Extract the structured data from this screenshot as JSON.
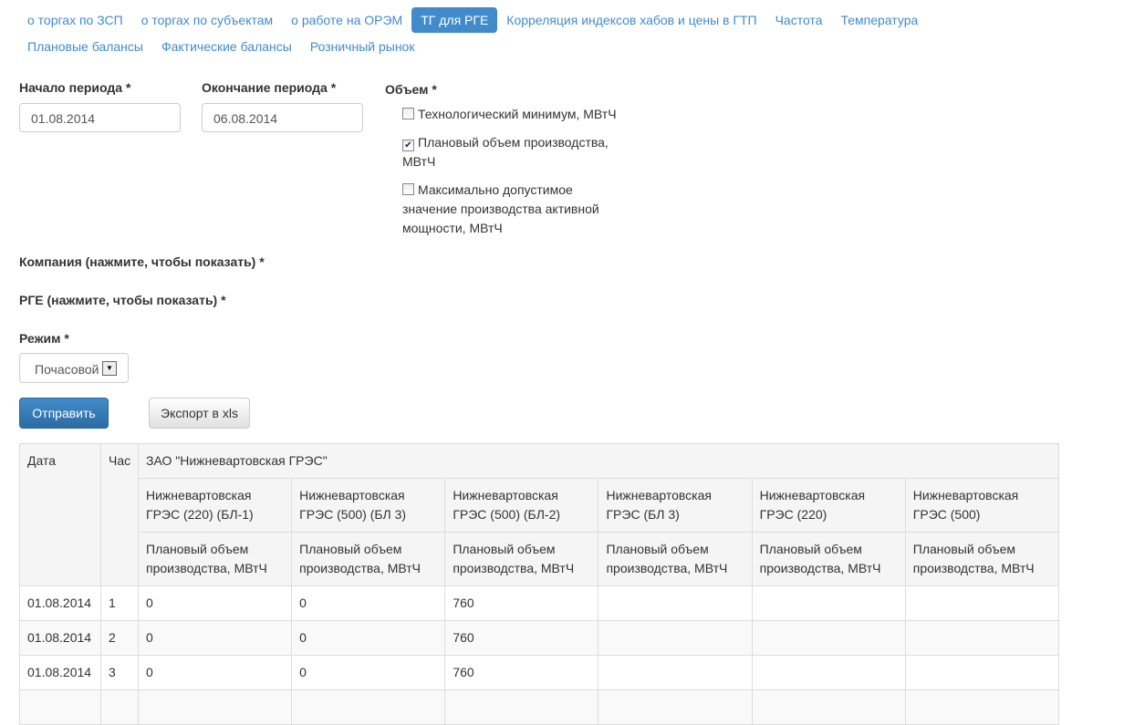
{
  "nav": [
    "о торгах по ЗСП",
    "о торгах по субъектам",
    "о работе на ОРЭМ",
    "ТГ для РГЕ",
    "Корреляция индексов хабов и цены в ГТП",
    "Частота",
    "Температура",
    "Плановые балансы",
    "Фактические балансы",
    "Розничный рынок"
  ],
  "form": {
    "start_label": "Начало периода *",
    "start_value": "01.08.2014",
    "end_label": "Окончание периода *",
    "end_value": "06.08.2014",
    "volume_label": "Объем *",
    "volume_options": [
      {
        "label": "Технологический минимум, МВтЧ",
        "checked": false
      },
      {
        "label": "Плановый объем производства, МВтЧ",
        "checked": true
      },
      {
        "label": "Максимально допустимое значение производства активной мощности, МВтЧ",
        "checked": false
      }
    ],
    "company_label": "Компания (нажмите, чтобы показать) *",
    "rge_label": "РГЕ (нажмите, чтобы показать) *",
    "mode_label": "Режим *",
    "mode_value": "Почасовой",
    "submit": "Отправить",
    "export": "Экспорт в xls"
  },
  "table": {
    "col_date": "Дата",
    "col_hour": "Час",
    "company": "ЗАО \"Нижневартовская ГРЭС\"",
    "units": [
      "Нижневартовская ГРЭС (220) (БЛ-1)",
      "Нижневартовская ГРЭС (500) (БЛ 3)",
      "Нижневартовская ГРЭС (500) (БЛ-2)",
      "Нижневартовская ГРЭС (БЛ 3)",
      "Нижневартовская ГРЭС (220)",
      "Нижневартовская ГРЭС (500)"
    ],
    "measure": "Плановый объем производства, МВтЧ",
    "rows": [
      {
        "date": "01.08.2014",
        "hour": "1",
        "vals": [
          "0",
          "0",
          "760",
          "",
          "",
          ""
        ]
      },
      {
        "date": "01.08.2014",
        "hour": "2",
        "vals": [
          "0",
          "0",
          "760",
          "",
          "",
          ""
        ]
      },
      {
        "date": "01.08.2014",
        "hour": "3",
        "vals": [
          "0",
          "0",
          "760",
          "",
          "",
          ""
        ]
      },
      {
        "date": "",
        "hour": "",
        "vals": [
          "",
          "",
          "",
          "",
          "",
          ""
        ]
      }
    ]
  }
}
